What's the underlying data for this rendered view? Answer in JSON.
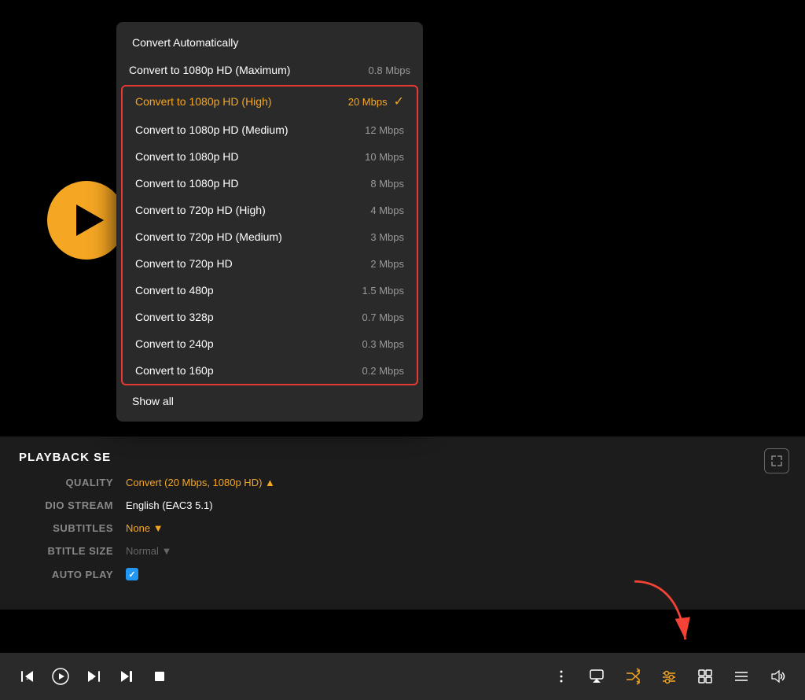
{
  "video": {
    "background": "#000000"
  },
  "dropdown": {
    "top_item": "Convert Automatically",
    "items": [
      {
        "label": "Convert to 1080p HD (Maximum)",
        "speed": "0.8 Mbps",
        "selected": false
      },
      {
        "label": "Convert to 1080p HD (High)",
        "speed": "20 Mbps",
        "selected": true
      },
      {
        "label": "Convert to 1080p HD (Medium)",
        "speed": "12 Mbps",
        "selected": false
      },
      {
        "label": "Convert to 1080p HD",
        "speed": "10 Mbps",
        "selected": false
      },
      {
        "label": "Convert to 1080p HD",
        "speed": "8 Mbps",
        "selected": false
      },
      {
        "label": "Convert to 720p HD (High)",
        "speed": "4 Mbps",
        "selected": false
      },
      {
        "label": "Convert to 720p HD (Medium)",
        "speed": "3 Mbps",
        "selected": false
      },
      {
        "label": "Convert to 720p HD",
        "speed": "2 Mbps",
        "selected": false
      },
      {
        "label": "Convert to 480p",
        "speed": "1.5 Mbps",
        "selected": false
      },
      {
        "label": "Convert to 328p",
        "speed": "0.7 Mbps",
        "selected": false
      },
      {
        "label": "Convert to 240p",
        "speed": "0.3 Mbps",
        "selected": false
      },
      {
        "label": "Convert to 160p",
        "speed": "0.2 Mbps",
        "selected": false
      }
    ],
    "bottom_item": "Show all"
  },
  "playback_settings": {
    "title": "PLAYBACK SE",
    "rows": [
      {
        "label": "QUALITY",
        "value": "Convert (20 Mbps, 1080p HD) ▲",
        "type": "orange"
      },
      {
        "label": "DIO STREAM",
        "value": "English (EAC3 5.1)",
        "type": "normal"
      },
      {
        "label": "SUBTITLES",
        "value": "None ▼",
        "type": "orange"
      },
      {
        "label": "BTITLE SIZE",
        "value": "Normal ▼",
        "type": "muted"
      },
      {
        "label": "AUTO PLAY",
        "value": "checkbox",
        "type": "checkbox"
      }
    ]
  },
  "controls": {
    "skip_back": "⟨10",
    "play": "▶",
    "skip_forward": "30⟩",
    "next": "⏭",
    "stop": "■",
    "more": "⋮",
    "airplay": "⬜",
    "shuffle": "⇄",
    "settings": "⚙",
    "grid": "⊞",
    "list": "≡",
    "volume": "🔊"
  }
}
